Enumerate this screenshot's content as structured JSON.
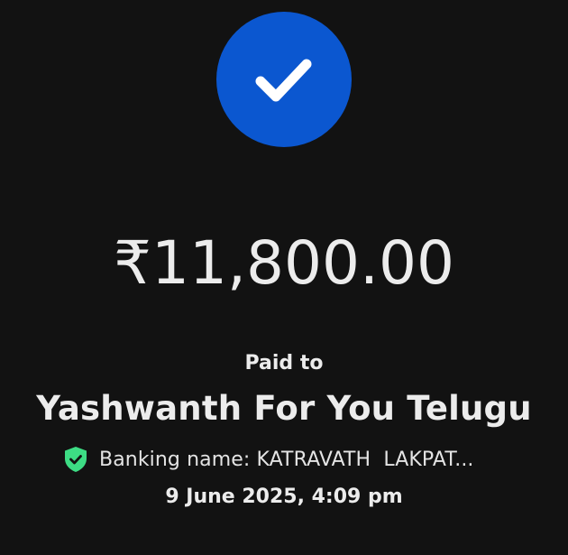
{
  "status": {
    "icon": "check-icon",
    "accent_color": "#0b57d0"
  },
  "payment": {
    "amount": "₹11,800.00",
    "paid_to_label": "Paid to",
    "payee_name": "Yashwanth For You Telugu",
    "banking_name_text": "Banking name: KATRAVATH  LAKPAT...",
    "verified_icon": "verified-shield-icon",
    "verified_color": "#3ddc84",
    "date_time": "9 June 2025, 4:09 pm"
  }
}
